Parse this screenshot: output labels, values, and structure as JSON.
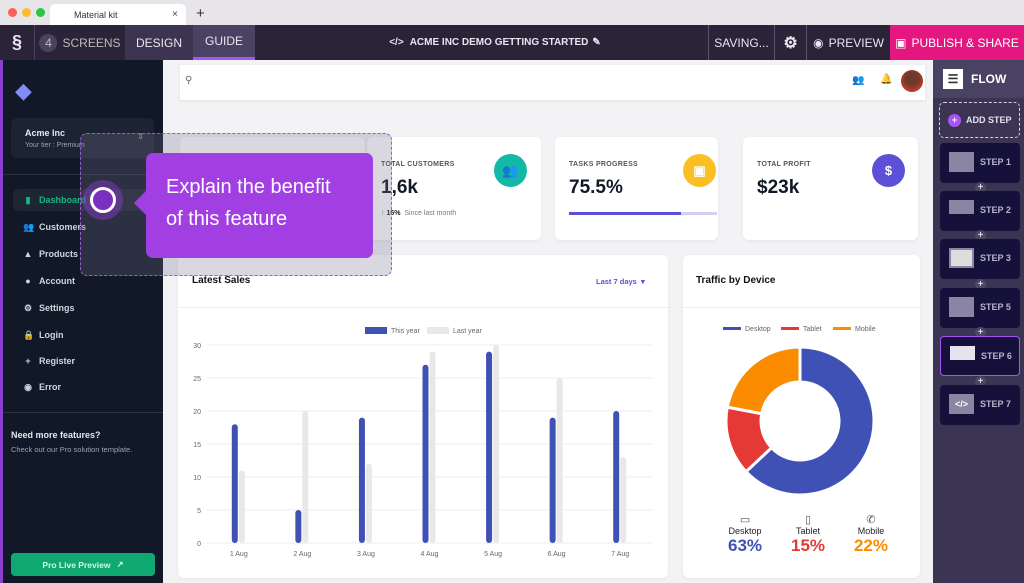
{
  "browser": {
    "tab_title": "Material kit",
    "close": "×",
    "new_tab": "+"
  },
  "toolbar": {
    "screens_count": "4",
    "screens_label": "SCREENS",
    "design": "DESIGN",
    "guide": "GUIDE",
    "title": "ACME INC DEMO GETTING STARTED",
    "code_glyph": "</>",
    "saving": "SAVING...",
    "preview": "PREVIEW",
    "publish": "PUBLISH & SHARE"
  },
  "sidebar": {
    "org": "Acme Inc",
    "tier": "Your tier : Premium",
    "items": [
      {
        "label": "Dashboard",
        "icon": "▮"
      },
      {
        "label": "Customers",
        "icon": "👥"
      },
      {
        "label": "Products",
        "icon": "▲"
      },
      {
        "label": "Account",
        "icon": "●"
      },
      {
        "label": "Settings",
        "icon": "⚙"
      },
      {
        "label": "Login",
        "icon": "🔒"
      },
      {
        "label": "Register",
        "icon": "+"
      },
      {
        "label": "Error",
        "icon": "◉"
      }
    ],
    "promo_title": "Need more features?",
    "promo_text": "Check out our Pro solution template.",
    "pro_button": "Pro Live Preview"
  },
  "kpis": {
    "customers": {
      "label": "TOTAL CUSTOMERS",
      "value": "1,6k",
      "delta": "16%",
      "since": "Since last month"
    },
    "tasks": {
      "label": "TASKS PROGRESS",
      "value": "75.5%",
      "progress": 75.5
    },
    "profit": {
      "label": "TOTAL PROFIT",
      "value": "$23k",
      "icon": "$"
    }
  },
  "sales": {
    "title": "Latest Sales",
    "range": "Last 7 days"
  },
  "traffic": {
    "title": "Traffic by Device",
    "devices": [
      {
        "name": "Desktop",
        "value": "63%"
      },
      {
        "name": "Tablet",
        "value": "15%"
      },
      {
        "name": "Mobile",
        "value": "22%"
      }
    ]
  },
  "tooltip": {
    "text1": "Explain the benefit",
    "text2": "of this feature"
  },
  "flow": {
    "title": "FLOW",
    "add_step": "ADD STEP",
    "steps": [
      "STEP 1",
      "STEP 2",
      "STEP 3",
      "STEP 5",
      "STEP 6",
      "STEP 7"
    ]
  },
  "colors": {
    "accent": "#a13fe2",
    "publish": "#e3177f",
    "this_year": "#3f51b5",
    "last_year": "#e8e8e8",
    "desktop": "#3f51b5",
    "tablet": "#e53935",
    "mobile": "#fb8c00",
    "sidebar_active": "#10b981"
  },
  "chart_data": [
    {
      "type": "bar",
      "categories": [
        "1 Aug",
        "2 Aug",
        "3 Aug",
        "4 Aug",
        "5 Aug",
        "6 Aug",
        "7 Aug"
      ],
      "series": [
        {
          "name": "This year",
          "values": [
            18,
            5,
            19,
            27,
            29,
            19,
            20
          ]
        },
        {
          "name": "Last year",
          "values": [
            11,
            20,
            12,
            29,
            30,
            25,
            13
          ]
        }
      ],
      "ylim": [
        0,
        30
      ],
      "yticks": [
        0,
        5,
        10,
        15,
        20,
        25,
        30
      ],
      "grid": true,
      "legend": "top"
    },
    {
      "type": "pie",
      "labels": [
        "Desktop",
        "Tablet",
        "Mobile"
      ],
      "values": [
        63,
        15,
        22
      ],
      "legend": "top",
      "donut": true
    }
  ]
}
